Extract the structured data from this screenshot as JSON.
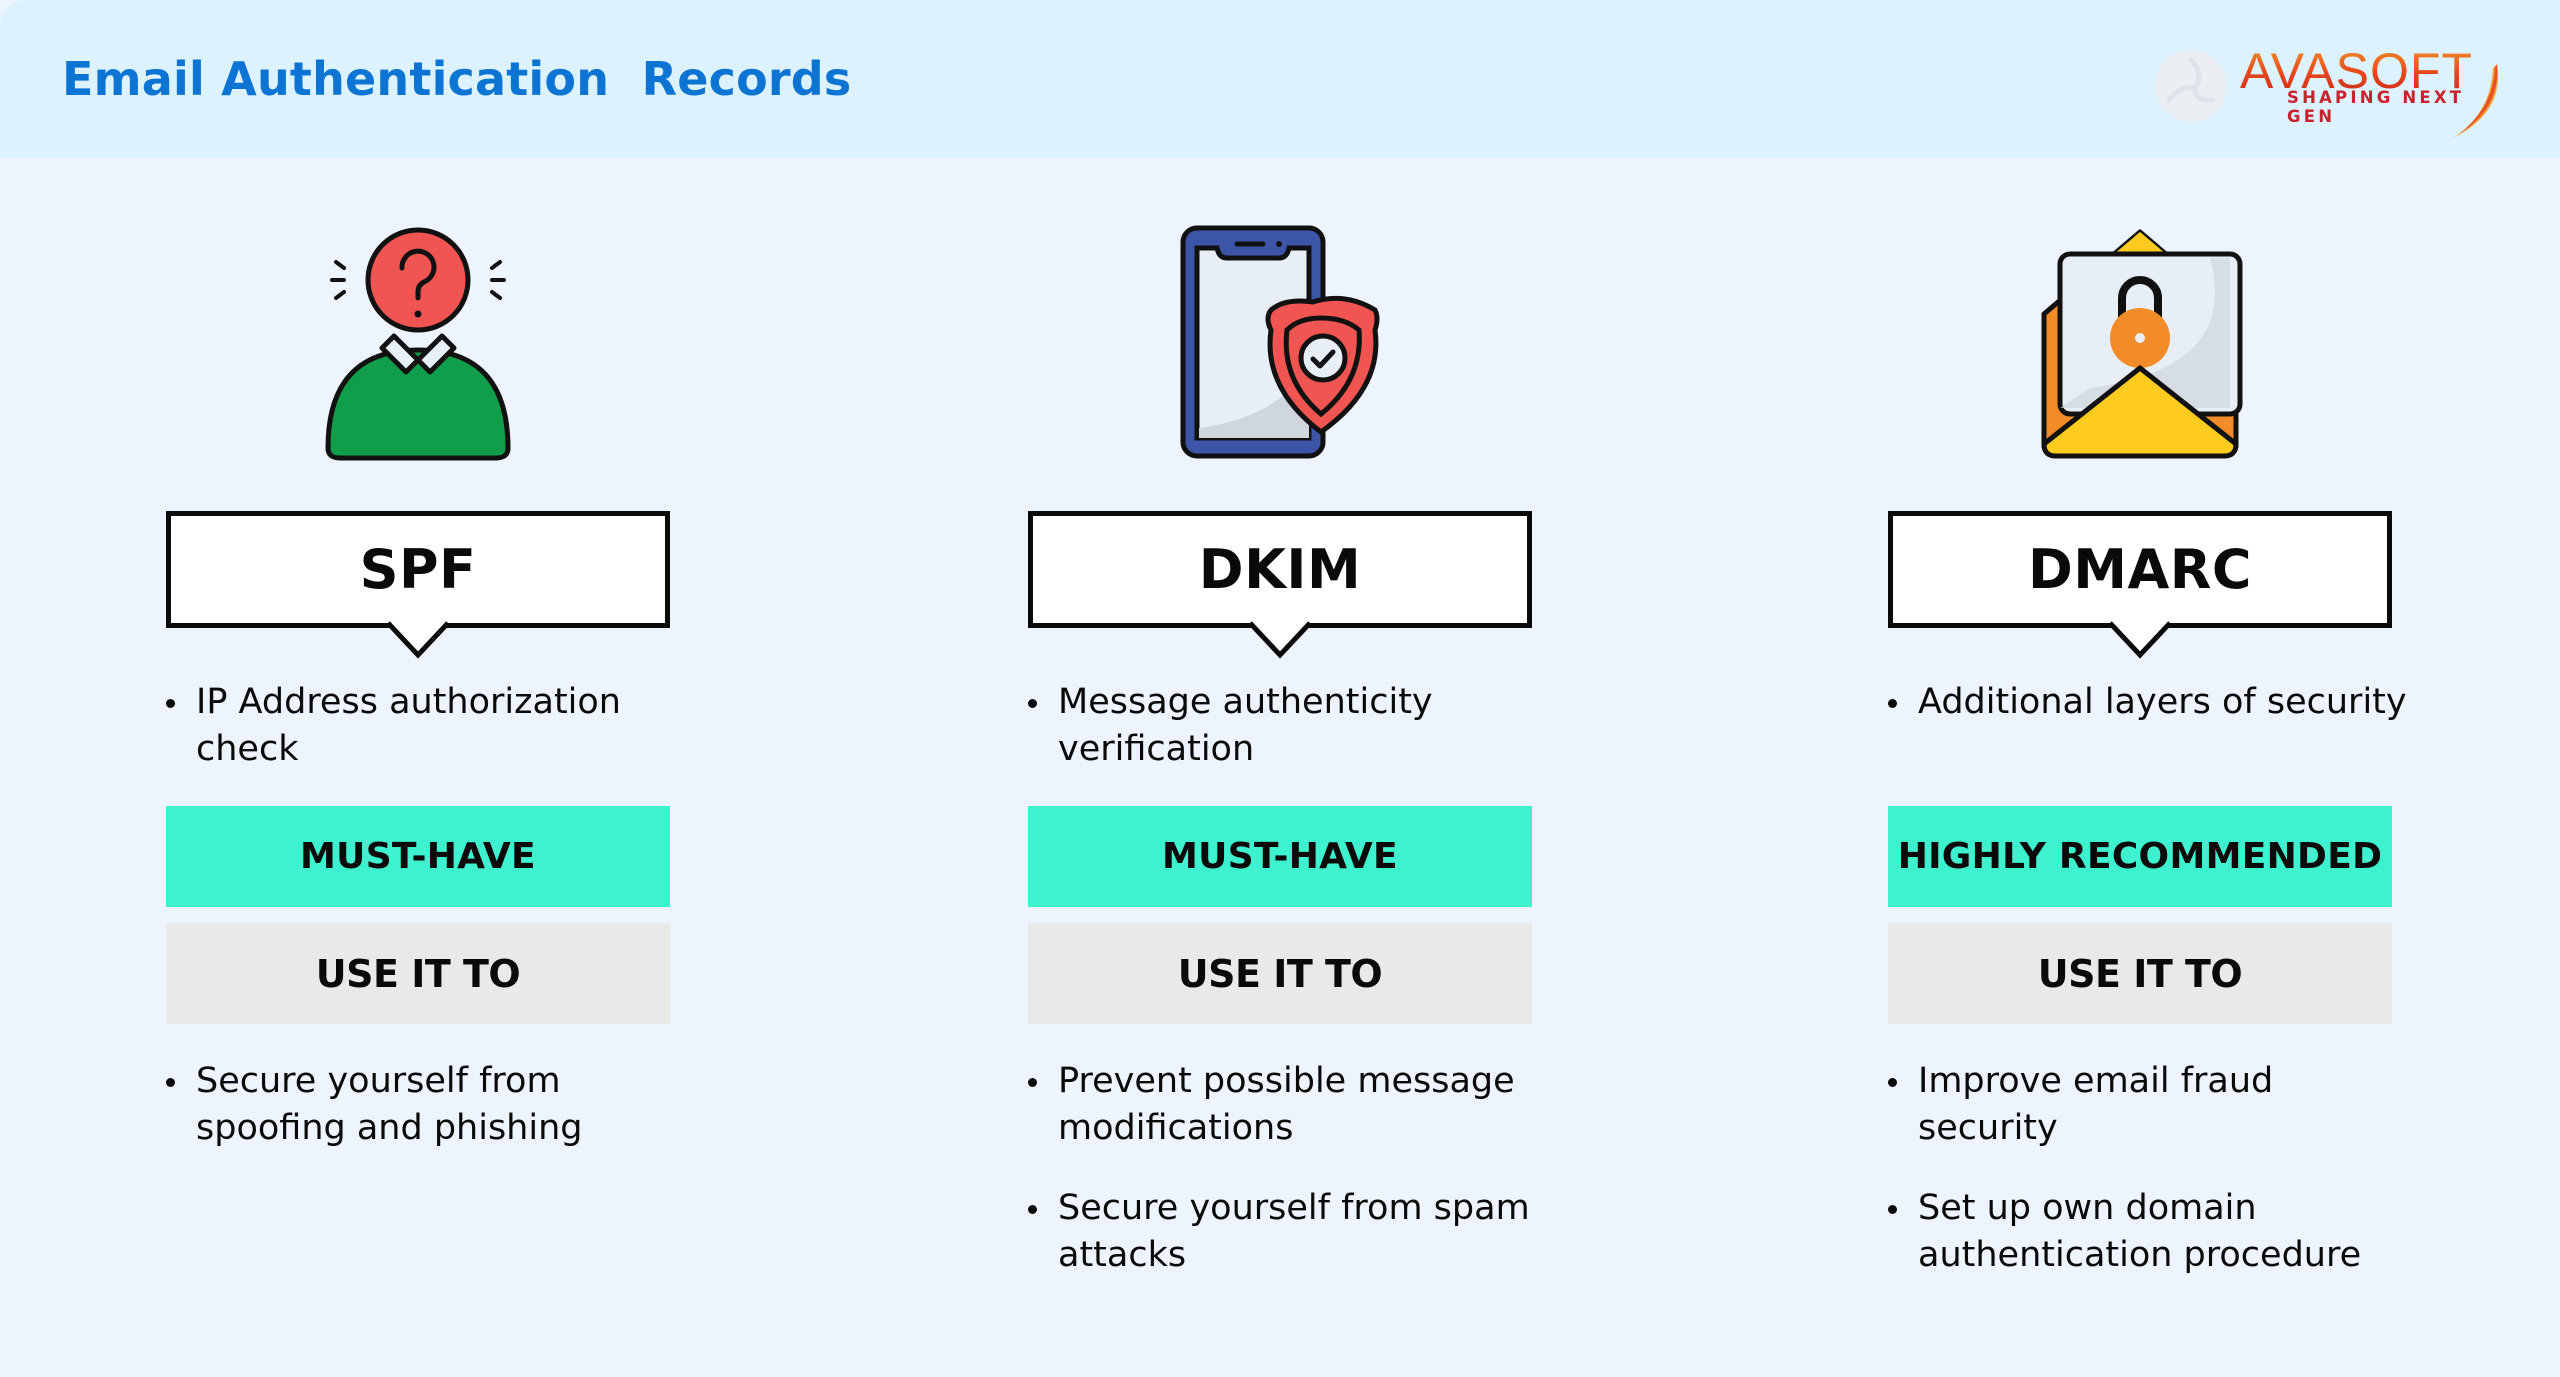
{
  "header": {
    "title": "Email Authentication  Records",
    "logo": {
      "brand": "AVASOFT",
      "tagline": "SHAPING NEXT GEN",
      "mark_icon": "avasoft-tri-swirl-icon"
    }
  },
  "colors": {
    "title": "#0c74d3",
    "header_bg": "#ddf2ff",
    "page_bg": "#eef4fd",
    "badge_bg": "#3ff2cf",
    "useit_bg": "#e9e9e9"
  },
  "columns": [
    {
      "name": "SPF",
      "icon": "person-question-icon",
      "description": [
        "IP Address authorization check"
      ],
      "badge": "MUST-HAVE",
      "use_label": "USE IT TO",
      "uses": [
        "Secure yourself from spoofing and phishing"
      ]
    },
    {
      "name": "DKIM",
      "icon": "phone-shield-check-icon",
      "description": [
        "Message authenticity verification"
      ],
      "badge": "MUST-HAVE",
      "use_label": "USE IT TO",
      "uses": [
        "Prevent possible message modifications",
        "Secure yourself from spam attacks"
      ]
    },
    {
      "name": "DMARC",
      "icon": "envelope-lock-icon",
      "description": [
        "Additional layers of security"
      ],
      "badge": "HIGHLY RECOMMENDED",
      "use_label": "USE IT TO",
      "uses": [
        "Improve email fraud security",
        "Set up own domain authentication procedure"
      ]
    }
  ]
}
